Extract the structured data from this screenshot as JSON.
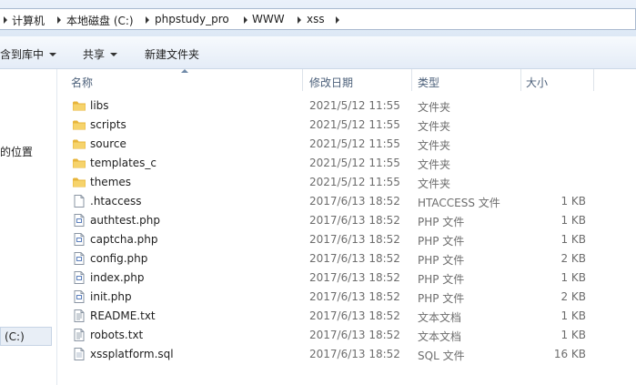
{
  "address_bar": {
    "path": [
      "计算机",
      "本地磁盘 (C:)",
      "phpstudy_pro",
      "WWW",
      "xss"
    ]
  },
  "toolbar": {
    "include_label": "含到库中",
    "share_label": "共享",
    "new_folder_label": "新建文件夹"
  },
  "nav": {
    "items": [
      {
        "label": "的位置"
      },
      {
        "label": "(C:)"
      }
    ]
  },
  "columns": {
    "name": "名称",
    "date": "修改日期",
    "type": "类型",
    "size": "大小"
  },
  "files": [
    {
      "name": "libs",
      "date": "2021/5/12 11:55",
      "type": "文件夹",
      "size": "",
      "icon": "folder-icon"
    },
    {
      "name": "scripts",
      "date": "2021/5/12 11:55",
      "type": "文件夹",
      "size": "",
      "icon": "folder-icon"
    },
    {
      "name": "source",
      "date": "2021/5/12 11:55",
      "type": "文件夹",
      "size": "",
      "icon": "folder-icon"
    },
    {
      "name": "templates_c",
      "date": "2021/5/12 11:55",
      "type": "文件夹",
      "size": "",
      "icon": "folder-icon"
    },
    {
      "name": "themes",
      "date": "2021/5/12 11:55",
      "type": "文件夹",
      "size": "",
      "icon": "folder-icon"
    },
    {
      "name": ".htaccess",
      "date": "2017/6/13 18:52",
      "type": "HTACCESS 文件",
      "size": "1 KB",
      "icon": "blank-file-icon"
    },
    {
      "name": "authtest.php",
      "date": "2017/6/13 18:52",
      "type": "PHP 文件",
      "size": "1 KB",
      "icon": "php-file-icon"
    },
    {
      "name": "captcha.php",
      "date": "2017/6/13 18:52",
      "type": "PHP 文件",
      "size": "1 KB",
      "icon": "php-file-icon"
    },
    {
      "name": "config.php",
      "date": "2017/6/13 18:52",
      "type": "PHP 文件",
      "size": "2 KB",
      "icon": "php-file-icon"
    },
    {
      "name": "index.php",
      "date": "2017/6/13 18:52",
      "type": "PHP 文件",
      "size": "1 KB",
      "icon": "php-file-icon"
    },
    {
      "name": "init.php",
      "date": "2017/6/13 18:52",
      "type": "PHP 文件",
      "size": "2 KB",
      "icon": "php-file-icon"
    },
    {
      "name": "README.txt",
      "date": "2017/6/13 18:52",
      "type": "文本文档",
      "size": "1 KB",
      "icon": "text-file-icon"
    },
    {
      "name": "robots.txt",
      "date": "2017/6/13 18:52",
      "type": "文本文档",
      "size": "1 KB",
      "icon": "text-file-icon"
    },
    {
      "name": "xssplatform.sql",
      "date": "2017/6/13 18:52",
      "type": "SQL 文件",
      "size": "16 KB",
      "icon": "sql-file-icon"
    }
  ],
  "colors": {
    "folder": "#f2c94c",
    "header_text": "#4c607a",
    "detail_text": "#6d6d6d"
  }
}
